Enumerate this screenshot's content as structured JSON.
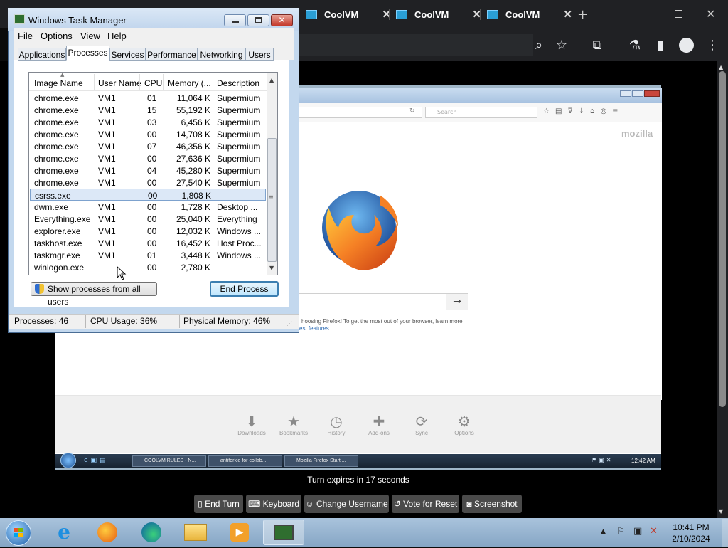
{
  "browser": {
    "tabs": [
      {
        "label": "CoolVM"
      },
      {
        "label": "CoolVM"
      },
      {
        "label": "CoolVM"
      }
    ],
    "new_tab_glyph": "+",
    "close_glyph": "✕"
  },
  "vm_screen": {
    "firefox": {
      "search_placeholder": "Search",
      "brand": "mozilla",
      "note_line1": "hoosing Firefox! To get the most out of your browser, learn more",
      "note_line2": "est features.",
      "bottom_buttons": [
        {
          "label": "Downloads",
          "icon": "download-icon"
        },
        {
          "label": "Bookmarks",
          "icon": "star-icon"
        },
        {
          "label": "History",
          "icon": "clock-icon"
        },
        {
          "label": "Add-ons",
          "icon": "puzzle-icon"
        },
        {
          "label": "Sync",
          "icon": "sync-icon"
        },
        {
          "label": "Options",
          "icon": "gear-icon"
        }
      ]
    },
    "taskbar": {
      "items": [
        "COOLVM RULES - N...",
        "antiforkie for collab...",
        "Mozilla Firefox Start ..."
      ],
      "time": "12:42 AM"
    }
  },
  "task_manager": {
    "title": "Windows Task Manager",
    "menu": [
      "File",
      "Options",
      "View",
      "Help"
    ],
    "tabs": [
      "Applications",
      "Processes",
      "Services",
      "Performance",
      "Networking",
      "Users"
    ],
    "columns": [
      "Image Name",
      "User Name",
      "CPU",
      "Memory (...",
      "Description"
    ],
    "rows": [
      {
        "image": "chrome.exe",
        "user": "VM1",
        "cpu": "01",
        "mem": "11,064 K",
        "desc": "Supermium"
      },
      {
        "image": "chrome.exe",
        "user": "VM1",
        "cpu": "15",
        "mem": "55,192 K",
        "desc": "Supermium"
      },
      {
        "image": "chrome.exe",
        "user": "VM1",
        "cpu": "03",
        "mem": "6,456 K",
        "desc": "Supermium"
      },
      {
        "image": "chrome.exe",
        "user": "VM1",
        "cpu": "00",
        "mem": "14,708 K",
        "desc": "Supermium"
      },
      {
        "image": "chrome.exe",
        "user": "VM1",
        "cpu": "07",
        "mem": "46,356 K",
        "desc": "Supermium"
      },
      {
        "image": "chrome.exe",
        "user": "VM1",
        "cpu": "00",
        "mem": "27,636 K",
        "desc": "Supermium"
      },
      {
        "image": "chrome.exe",
        "user": "VM1",
        "cpu": "04",
        "mem": "45,280 K",
        "desc": "Supermium"
      },
      {
        "image": "chrome.exe",
        "user": "VM1",
        "cpu": "00",
        "mem": "27,540 K",
        "desc": "Supermium"
      },
      {
        "image": "csrss.exe",
        "user": "",
        "cpu": "00",
        "mem": "1,808 K",
        "desc": ""
      },
      {
        "image": "dwm.exe",
        "user": "VM1",
        "cpu": "00",
        "mem": "1,728 K",
        "desc": "Desktop ..."
      },
      {
        "image": "Everything.exe",
        "user": "VM1",
        "cpu": "00",
        "mem": "25,040 K",
        "desc": "Everything"
      },
      {
        "image": "explorer.exe",
        "user": "VM1",
        "cpu": "00",
        "mem": "12,032 K",
        "desc": "Windows ..."
      },
      {
        "image": "taskhost.exe",
        "user": "VM1",
        "cpu": "00",
        "mem": "16,452 K",
        "desc": "Host Proc..."
      },
      {
        "image": "taskmgr.exe",
        "user": "VM1",
        "cpu": "01",
        "mem": "3,448 K",
        "desc": "Windows ..."
      },
      {
        "image": "winlogon.exe",
        "user": "",
        "cpu": "00",
        "mem": "2,780 K",
        "desc": ""
      }
    ],
    "selected_row": 8,
    "show_all_label": "Show processes from all users",
    "end_process_label": "End Process",
    "status": {
      "processes": "Processes: 46",
      "cpu": "CPU Usage: 36%",
      "memory": "Physical Memory: 46%"
    }
  },
  "collabvm": {
    "turn_text": "Turn expires in 17 seconds",
    "buttons": [
      {
        "label": "End Turn",
        "icon": "doc-icon"
      },
      {
        "label": "Keyboard",
        "icon": "keyboard-icon"
      },
      {
        "label": "Change Username",
        "icon": "users-icon"
      },
      {
        "label": "Vote for Reset",
        "icon": "undo-icon"
      },
      {
        "label": "Screenshot",
        "icon": "camera-icon"
      }
    ]
  },
  "host_taskbar": {
    "time": "10:41 PM",
    "date": "2/10/2024"
  }
}
